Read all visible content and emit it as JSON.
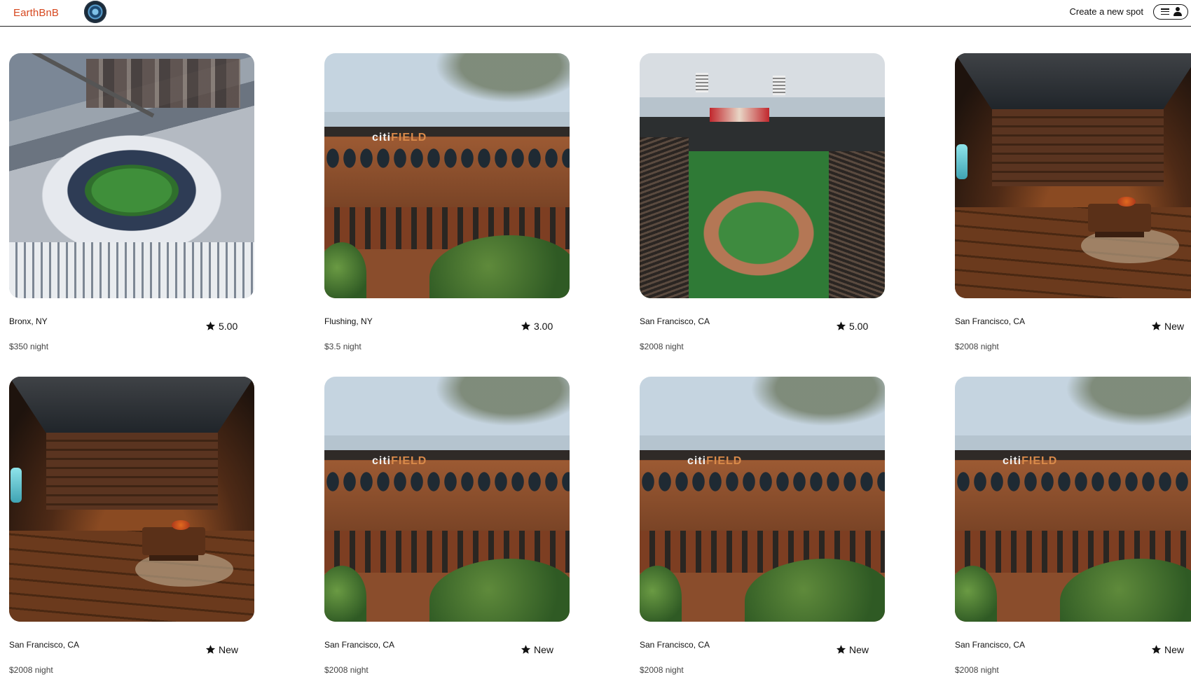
{
  "app": {
    "brand": "EarthBnB"
  },
  "header": {
    "create_spot_label": "Create a new spot"
  },
  "listings": [
    {
      "location": "Bronx, NY",
      "rating": "5.00",
      "price": "$350 night",
      "photo": "yankee-stadium"
    },
    {
      "location": "Flushing, NY",
      "rating": "3.00",
      "price": "$3.5 night",
      "photo": "citi-field"
    },
    {
      "location": "San Francisco, CA",
      "rating": "5.00",
      "price": "$2008 night",
      "photo": "oracle-park"
    },
    {
      "location": "San Francisco, CA",
      "rating": "New",
      "price": "$2008 night",
      "photo": "tavern-interior"
    },
    {
      "location": "San Francisco, CA",
      "rating": "New",
      "price": "$2008 night",
      "photo": "tavern-interior"
    },
    {
      "location": "San Francisco, CA",
      "rating": "New",
      "price": "$2008 night",
      "photo": "citi-field"
    },
    {
      "location": "San Francisco, CA",
      "rating": "New",
      "price": "$2008 night",
      "photo": "citi-field"
    },
    {
      "location": "San Francisco, CA",
      "rating": "New",
      "price": "$2008 night",
      "photo": "citi-field"
    }
  ],
  "photo_labels": {
    "citi_sign_a": "citi",
    "citi_sign_b": "FIELD"
  },
  "colors": {
    "brand": "#d6481f",
    "text": "#111111",
    "muted": "#444444"
  },
  "icons": {
    "rating": "star-icon",
    "menu": "hamburger-menu-icon",
    "user": "user-icon",
    "logo": "swirl-logo-icon"
  }
}
